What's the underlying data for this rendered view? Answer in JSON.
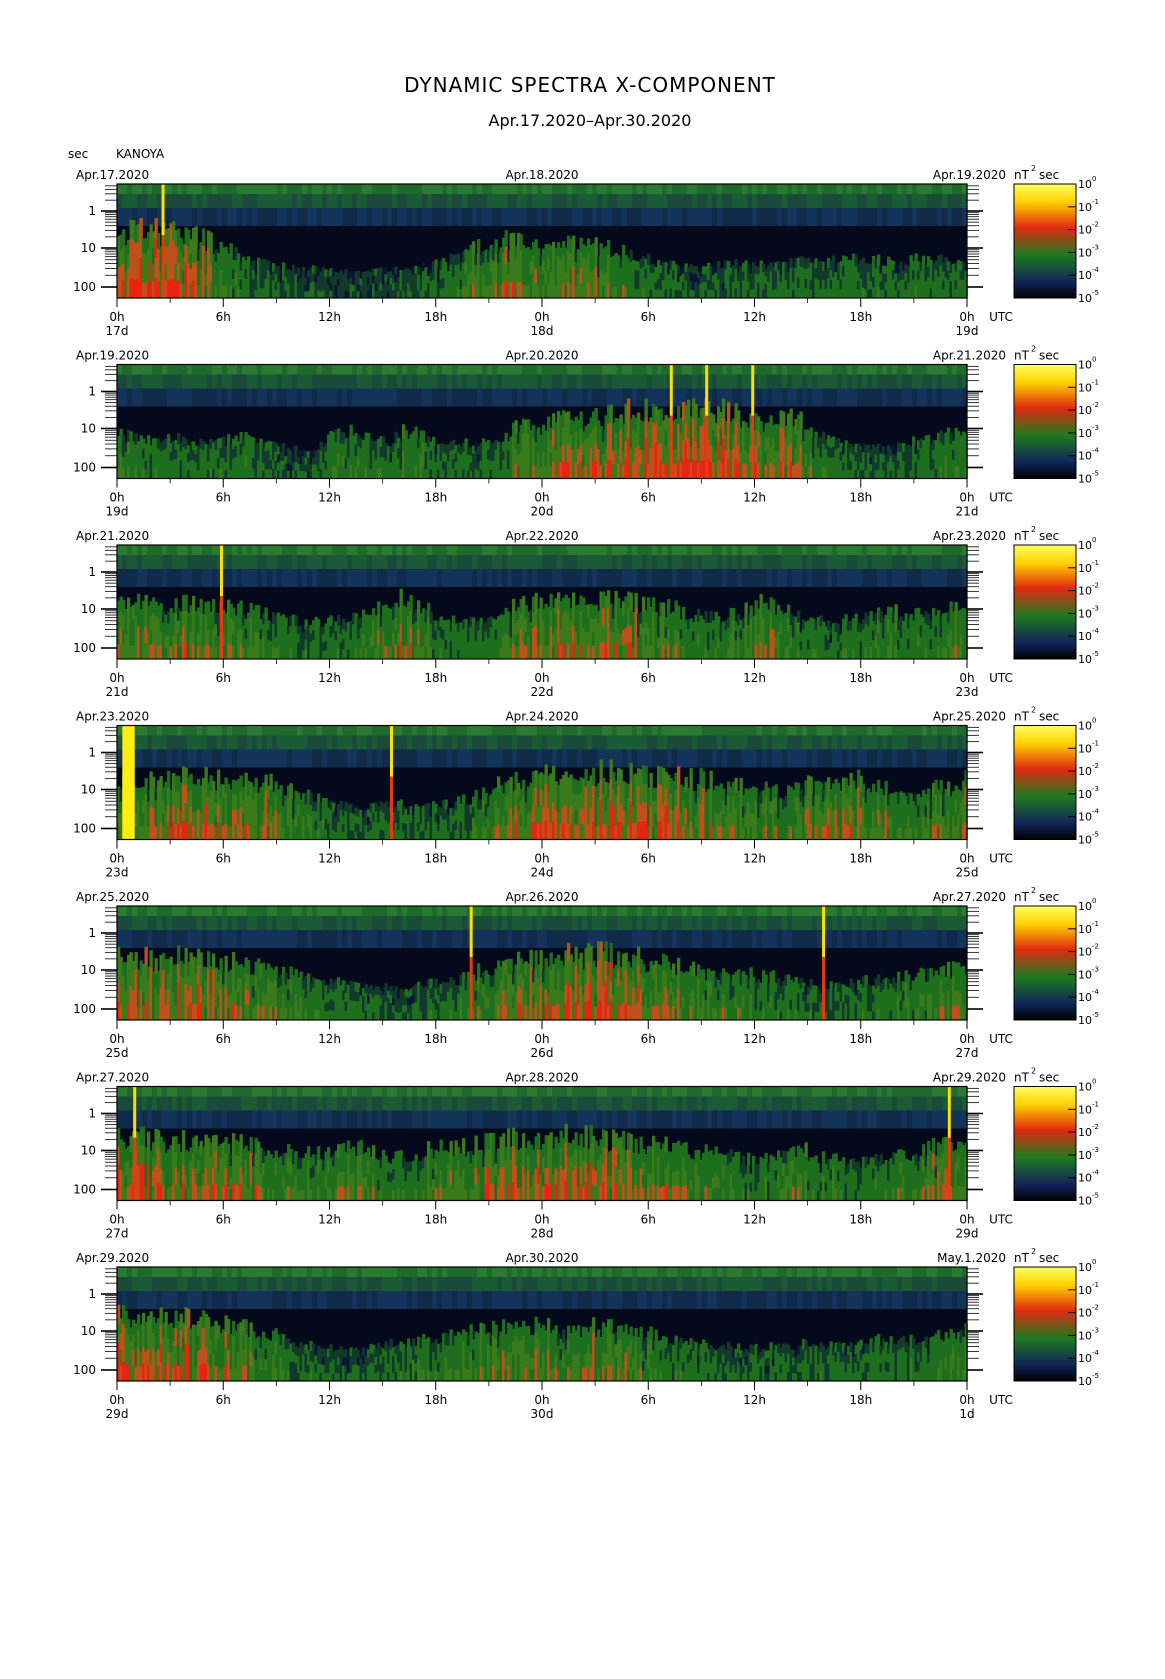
{
  "title": "DYNAMIC SPECTRA X-COMPONENT",
  "subtitle": "Apr.17.2020–Apr.30.2020",
  "station": "KANOYA",
  "yunit": "sec",
  "colorbar_unit": "nT",
  "colorbar_unit_exp": "2",
  "colorbar_unit_sec": "sec",
  "utc_label": "UTC",
  "colors": {
    "background": "#ffffff",
    "gradient": [
      "#000000",
      "#10245a",
      "#1f7a1f",
      "#e02a10",
      "#ffd000",
      "#ffff60"
    ]
  },
  "chart_data": [
    {
      "type": "heatmap",
      "left_date": "Apr.17.2020",
      "mid_date": "Apr.18.2020",
      "right_date": "Apr.19.2020",
      "x_tick_labels": [
        "0h",
        "6h",
        "12h",
        "18h",
        "0h",
        "6h",
        "12h",
        "18h",
        "0h"
      ],
      "day_labels": [
        "17d",
        "18d",
        "19d"
      ],
      "y_tick_labels": [
        "1",
        "10",
        "100"
      ],
      "colorbar_exponents": [
        "0",
        "-1",
        "-2",
        "-3",
        "-4",
        "-5"
      ],
      "spikes_hours": [
        2.6
      ],
      "activity_profile": [
        0.8,
        0.9,
        0.85,
        0.8,
        0.75,
        0.7,
        0.55,
        0.4,
        0.3,
        0.25,
        0.2,
        0.2,
        0.15,
        0.15,
        0.15,
        0.2,
        0.2,
        0.25,
        0.3,
        0.45,
        0.6,
        0.7,
        0.65,
        0.6,
        0.55,
        0.6,
        0.65,
        0.55,
        0.5,
        0.4,
        0.3,
        0.25,
        0.2,
        0.25,
        0.3,
        0.3,
        0.25,
        0.3,
        0.35,
        0.3,
        0.35,
        0.4,
        0.35,
        0.3,
        0.35,
        0.4,
        0.3,
        0.25
      ]
    },
    {
      "type": "heatmap",
      "left_date": "Apr.19.2020",
      "mid_date": "Apr.20.2020",
      "right_date": "Apr.21.2020",
      "x_tick_labels": [
        "0h",
        "6h",
        "12h",
        "18h",
        "0h",
        "6h",
        "12h",
        "18h",
        "0h"
      ],
      "day_labels": [
        "19d",
        "20d",
        "21d"
      ],
      "y_tick_labels": [
        "1",
        "10",
        "100"
      ],
      "colorbar_exponents": [
        "0",
        "-1",
        "-2",
        "-3",
        "-4",
        "-5"
      ],
      "spikes_hours": [
        31.3,
        33.3,
        35.9
      ],
      "activity_profile": [
        0.45,
        0.4,
        0.35,
        0.4,
        0.35,
        0.3,
        0.35,
        0.4,
        0.3,
        0.25,
        0.2,
        0.2,
        0.45,
        0.5,
        0.4,
        0.3,
        0.55,
        0.4,
        0.3,
        0.3,
        0.3,
        0.3,
        0.55,
        0.6,
        0.65,
        0.7,
        0.7,
        0.75,
        0.85,
        0.9,
        0.95,
        0.95,
        1.0,
        0.9,
        0.8,
        0.75,
        0.7,
        0.75,
        0.65,
        0.4,
        0.3,
        0.25,
        0.25,
        0.3,
        0.35,
        0.4,
        0.45,
        0.5
      ]
    },
    {
      "type": "heatmap",
      "left_date": "Apr.21.2020",
      "mid_date": "Apr.22.2020",
      "right_date": "Apr.23.2020",
      "x_tick_labels": [
        "0h",
        "6h",
        "12h",
        "18h",
        "0h",
        "6h",
        "12h",
        "18h",
        "0h"
      ],
      "day_labels": [
        "21d",
        "22d",
        "23d"
      ],
      "y_tick_labels": [
        "1",
        "10",
        "100"
      ],
      "colorbar_exponents": [
        "0",
        "-1",
        "-2",
        "-3",
        "-4",
        "-5"
      ],
      "spikes_hours": [
        5.9
      ],
      "activity_profile": [
        0.6,
        0.65,
        0.6,
        0.65,
        0.7,
        0.65,
        0.6,
        0.55,
        0.5,
        0.4,
        0.35,
        0.35,
        0.35,
        0.4,
        0.5,
        0.6,
        0.75,
        0.55,
        0.4,
        0.35,
        0.4,
        0.5,
        0.6,
        0.65,
        0.7,
        0.65,
        0.7,
        0.75,
        0.7,
        0.65,
        0.6,
        0.55,
        0.45,
        0.4,
        0.45,
        0.55,
        0.7,
        0.55,
        0.4,
        0.35,
        0.35,
        0.4,
        0.45,
        0.5,
        0.45,
        0.5,
        0.6,
        0.65
      ]
    },
    {
      "type": "heatmap",
      "left_date": "Apr.23.2020",
      "mid_date": "Apr.24.2020",
      "right_date": "Apr.25.2020",
      "x_tick_labels": [
        "0h",
        "6h",
        "12h",
        "18h",
        "0h",
        "6h",
        "12h",
        "18h",
        "0h"
      ],
      "day_labels": [
        "23d",
        "24d",
        "25d"
      ],
      "y_tick_labels": [
        "1",
        "10",
        "100"
      ],
      "colorbar_exponents": [
        "0",
        "-1",
        "-2",
        "-3",
        "-4",
        "-5"
      ],
      "spikes_hours": [
        15.5
      ],
      "data_gap_hours": [
        0.3,
        1.0
      ],
      "activity_profile": [
        0.8,
        0.75,
        0.7,
        0.75,
        0.8,
        0.75,
        0.7,
        0.75,
        0.7,
        0.6,
        0.5,
        0.4,
        0.3,
        0.25,
        0.25,
        0.3,
        0.3,
        0.25,
        0.3,
        0.35,
        0.45,
        0.6,
        0.7,
        0.75,
        0.8,
        0.85,
        0.8,
        0.85,
        0.9,
        0.85,
        0.8,
        0.75,
        0.75,
        0.7,
        0.65,
        0.6,
        0.55,
        0.5,
        0.6,
        0.7,
        0.75,
        0.7,
        0.6,
        0.55,
        0.5,
        0.55,
        0.6,
        0.7
      ]
    },
    {
      "type": "heatmap",
      "left_date": "Apr.25.2020",
      "mid_date": "Apr.26.2020",
      "right_date": "Apr.27.2020",
      "x_tick_labels": [
        "0h",
        "6h",
        "12h",
        "18h",
        "0h",
        "6h",
        "12h",
        "18h",
        "0h"
      ],
      "day_labels": [
        "25d",
        "26d",
        "27d"
      ],
      "y_tick_labels": [
        "1",
        "10",
        "100"
      ],
      "colorbar_exponents": [
        "0",
        "-1",
        "-2",
        "-3",
        "-4",
        "-5"
      ],
      "spikes_hours": [
        20.0,
        39.9
      ],
      "activity_profile": [
        0.85,
        0.8,
        0.75,
        0.8,
        0.75,
        0.7,
        0.7,
        0.65,
        0.6,
        0.55,
        0.45,
        0.4,
        0.35,
        0.3,
        0.3,
        0.25,
        0.25,
        0.3,
        0.35,
        0.4,
        0.55,
        0.65,
        0.7,
        0.75,
        0.8,
        0.85,
        0.8,
        0.85,
        0.8,
        0.75,
        0.7,
        0.65,
        0.55,
        0.5,
        0.45,
        0.5,
        0.45,
        0.4,
        0.35,
        0.3,
        0.3,
        0.35,
        0.4,
        0.4,
        0.45,
        0.5,
        0.55,
        0.6
      ]
    },
    {
      "type": "heatmap",
      "left_date": "Apr.27.2020",
      "mid_date": "Apr.28.2020",
      "right_date": "Apr.29.2020",
      "x_tick_labels": [
        "0h",
        "6h",
        "12h",
        "18h",
        "0h",
        "6h",
        "12h",
        "18h",
        "0h"
      ],
      "day_labels": [
        "27d",
        "28d",
        "29d"
      ],
      "y_tick_labels": [
        "1",
        "10",
        "100"
      ],
      "colorbar_exponents": [
        "0",
        "-1",
        "-2",
        "-3",
        "-4",
        "-5"
      ],
      "spikes_hours": [
        1.0,
        47.0
      ],
      "activity_profile": [
        0.85,
        0.8,
        0.75,
        0.7,
        0.75,
        0.7,
        0.7,
        0.65,
        0.6,
        0.55,
        0.55,
        0.5,
        0.5,
        0.6,
        0.55,
        0.45,
        0.45,
        0.55,
        0.6,
        0.6,
        0.65,
        0.7,
        0.75,
        0.7,
        0.75,
        0.8,
        0.8,
        0.75,
        0.7,
        0.7,
        0.65,
        0.6,
        0.55,
        0.5,
        0.45,
        0.4,
        0.45,
        0.5,
        0.55,
        0.45,
        0.4,
        0.35,
        0.4,
        0.45,
        0.5,
        0.6,
        0.75,
        0.8
      ]
    },
    {
      "type": "heatmap",
      "left_date": "Apr.29.2020",
      "mid_date": "Apr.30.2020",
      "right_date": "May.1.2020",
      "x_tick_labels": [
        "0h",
        "6h",
        "12h",
        "18h",
        "0h",
        "6h",
        "12h",
        "18h",
        "0h"
      ],
      "day_labels": [
        "29d",
        "30d",
        "1d"
      ],
      "y_tick_labels": [
        "1",
        "10",
        "100"
      ],
      "colorbar_exponents": [
        "0",
        "-1",
        "-2",
        "-3",
        "-4",
        "-5"
      ],
      "spikes_hours": [],
      "activity_profile": [
        0.85,
        0.8,
        0.75,
        0.8,
        0.75,
        0.7,
        0.65,
        0.6,
        0.55,
        0.45,
        0.35,
        0.3,
        0.25,
        0.25,
        0.3,
        0.35,
        0.35,
        0.4,
        0.45,
        0.5,
        0.55,
        0.6,
        0.6,
        0.65,
        0.6,
        0.55,
        0.6,
        0.65,
        0.6,
        0.55,
        0.5,
        0.4,
        0.35,
        0.3,
        0.3,
        0.25,
        0.3,
        0.3,
        0.35,
        0.3,
        0.3,
        0.35,
        0.4,
        0.35,
        0.4,
        0.45,
        0.5,
        0.6
      ]
    }
  ]
}
